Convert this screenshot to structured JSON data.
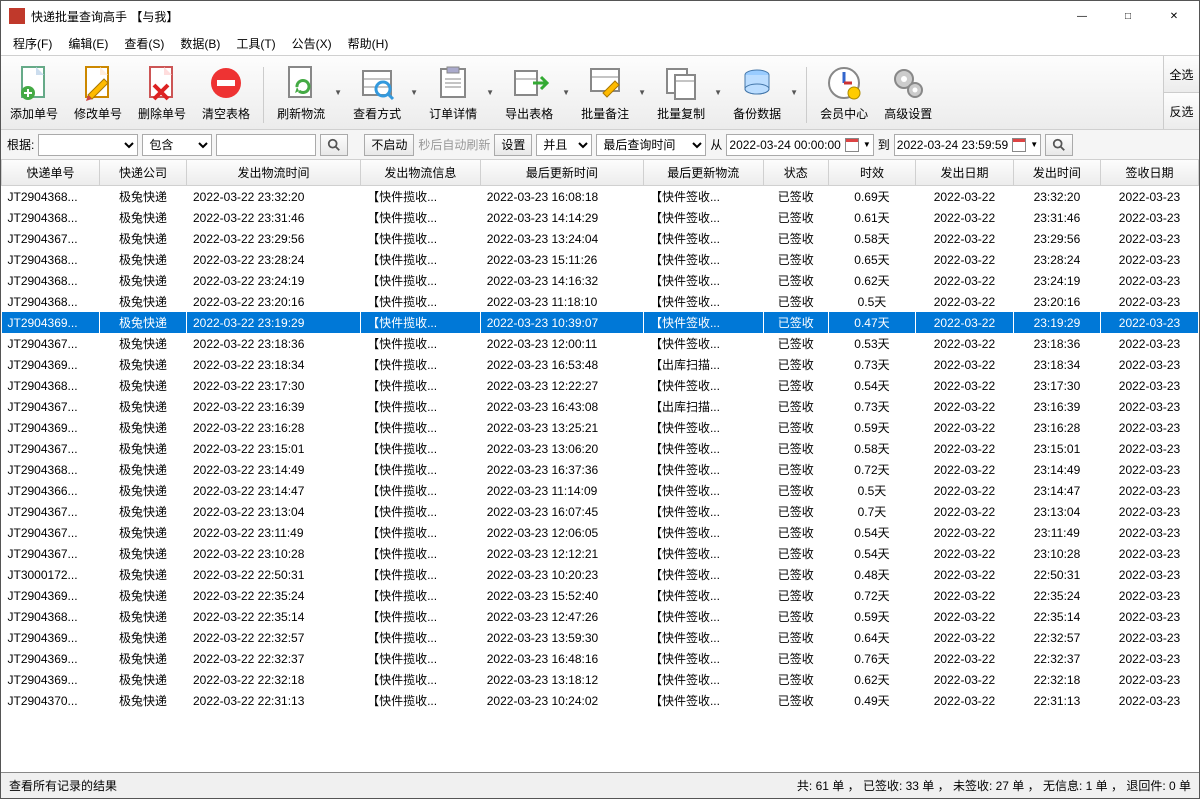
{
  "window": {
    "title": "快递批量查询高手 【与我】"
  },
  "menu": [
    "程序(F)",
    "编辑(E)",
    "查看(S)",
    "数据(B)",
    "工具(T)",
    "公告(X)",
    "帮助(H)"
  ],
  "toolbar": [
    {
      "id": "add",
      "label": "添加单号"
    },
    {
      "id": "edit",
      "label": "修改单号"
    },
    {
      "id": "del",
      "label": "删除单号"
    },
    {
      "id": "clear",
      "label": "清空表格"
    },
    {
      "id": "sep"
    },
    {
      "id": "refresh",
      "label": "刷新物流",
      "dd": true
    },
    {
      "id": "view",
      "label": "查看方式",
      "dd": true
    },
    {
      "id": "detail",
      "label": "订单详情",
      "dd": true
    },
    {
      "id": "export",
      "label": "导出表格",
      "dd": true
    },
    {
      "id": "remark",
      "label": "批量备注",
      "dd": true
    },
    {
      "id": "copy",
      "label": "批量复制",
      "dd": true
    },
    {
      "id": "backup",
      "label": "备份数据",
      "dd": true
    },
    {
      "id": "sep"
    },
    {
      "id": "vip",
      "label": "会员中心"
    },
    {
      "id": "adv",
      "label": "高级设置"
    }
  ],
  "side": {
    "all": "全选",
    "inv": "反选"
  },
  "filter": {
    "label_root": "根据:",
    "combo1": "",
    "combo2": "包含",
    "btn_no_start": "不启动",
    "hint": "秒后自动刷新",
    "btn_settings": "设置",
    "combo3": "并且",
    "combo4": "最后查询时间",
    "from": "从",
    "date_from": "2022-03-24 00:00:00",
    "to": "到",
    "date_to": "2022-03-24 23:59:59"
  },
  "columns": [
    "快递单号",
    "快递公司",
    "发出物流时间",
    "发出物流信息",
    "最后更新时间",
    "最后更新物流",
    "状态",
    "时效",
    "发出日期",
    "发出时间",
    "签收日期"
  ],
  "selected_row": 6,
  "rows": [
    [
      "JT2904368...",
      "极兔快递",
      "2022-03-22 23:32:20",
      "【快件揽收...",
      "2022-03-23 16:08:18",
      "【快件签收...",
      "已签收",
      "0.69天",
      "2022-03-22",
      "23:32:20",
      "2022-03-23"
    ],
    [
      "JT2904368...",
      "极兔快递",
      "2022-03-22 23:31:46",
      "【快件揽收...",
      "2022-03-23 14:14:29",
      "【快件签收...",
      "已签收",
      "0.61天",
      "2022-03-22",
      "23:31:46",
      "2022-03-23"
    ],
    [
      "JT2904367...",
      "极兔快递",
      "2022-03-22 23:29:56",
      "【快件揽收...",
      "2022-03-23 13:24:04",
      "【快件签收...",
      "已签收",
      "0.58天",
      "2022-03-22",
      "23:29:56",
      "2022-03-23"
    ],
    [
      "JT2904368...",
      "极兔快递",
      "2022-03-22 23:28:24",
      "【快件揽收...",
      "2022-03-23 15:11:26",
      "【快件签收...",
      "已签收",
      "0.65天",
      "2022-03-22",
      "23:28:24",
      "2022-03-23"
    ],
    [
      "JT2904368...",
      "极兔快递",
      "2022-03-22 23:24:19",
      "【快件揽收...",
      "2022-03-23 14:16:32",
      "【快件签收...",
      "已签收",
      "0.62天",
      "2022-03-22",
      "23:24:19",
      "2022-03-23"
    ],
    [
      "JT2904368...",
      "极兔快递",
      "2022-03-22 23:20:16",
      "【快件揽收...",
      "2022-03-23 11:18:10",
      "【快件签收...",
      "已签收",
      "0.5天",
      "2022-03-22",
      "23:20:16",
      "2022-03-23"
    ],
    [
      "JT2904369...",
      "极兔快递",
      "2022-03-22 23:19:29",
      "【快件揽收...",
      "2022-03-23 10:39:07",
      "【快件签收...",
      "已签收",
      "0.47天",
      "2022-03-22",
      "23:19:29",
      "2022-03-23"
    ],
    [
      "JT2904367...",
      "极兔快递",
      "2022-03-22 23:18:36",
      "【快件揽收...",
      "2022-03-23 12:00:11",
      "【快件签收...",
      "已签收",
      "0.53天",
      "2022-03-22",
      "23:18:36",
      "2022-03-23"
    ],
    [
      "JT2904369...",
      "极兔快递",
      "2022-03-22 23:18:34",
      "【快件揽收...",
      "2022-03-23 16:53:48",
      "【出库扫描...",
      "已签收",
      "0.73天",
      "2022-03-22",
      "23:18:34",
      "2022-03-23"
    ],
    [
      "JT2904368...",
      "极兔快递",
      "2022-03-22 23:17:30",
      "【快件揽收...",
      "2022-03-23 12:22:27",
      "【快件签收...",
      "已签收",
      "0.54天",
      "2022-03-22",
      "23:17:30",
      "2022-03-23"
    ],
    [
      "JT2904367...",
      "极兔快递",
      "2022-03-22 23:16:39",
      "【快件揽收...",
      "2022-03-23 16:43:08",
      "【出库扫描...",
      "已签收",
      "0.73天",
      "2022-03-22",
      "23:16:39",
      "2022-03-23"
    ],
    [
      "JT2904369...",
      "极兔快递",
      "2022-03-22 23:16:28",
      "【快件揽收...",
      "2022-03-23 13:25:21",
      "【快件签收...",
      "已签收",
      "0.59天",
      "2022-03-22",
      "23:16:28",
      "2022-03-23"
    ],
    [
      "JT2904367...",
      "极兔快递",
      "2022-03-22 23:15:01",
      "【快件揽收...",
      "2022-03-23 13:06:20",
      "【快件签收...",
      "已签收",
      "0.58天",
      "2022-03-22",
      "23:15:01",
      "2022-03-23"
    ],
    [
      "JT2904368...",
      "极兔快递",
      "2022-03-22 23:14:49",
      "【快件揽收...",
      "2022-03-23 16:37:36",
      "【快件签收...",
      "已签收",
      "0.72天",
      "2022-03-22",
      "23:14:49",
      "2022-03-23"
    ],
    [
      "JT2904366...",
      "极兔快递",
      "2022-03-22 23:14:47",
      "【快件揽收...",
      "2022-03-23 11:14:09",
      "【快件签收...",
      "已签收",
      "0.5天",
      "2022-03-22",
      "23:14:47",
      "2022-03-23"
    ],
    [
      "JT2904367...",
      "极兔快递",
      "2022-03-22 23:13:04",
      "【快件揽收...",
      "2022-03-23 16:07:45",
      "【快件签收...",
      "已签收",
      "0.7天",
      "2022-03-22",
      "23:13:04",
      "2022-03-23"
    ],
    [
      "JT2904367...",
      "极兔快递",
      "2022-03-22 23:11:49",
      "【快件揽收...",
      "2022-03-23 12:06:05",
      "【快件签收...",
      "已签收",
      "0.54天",
      "2022-03-22",
      "23:11:49",
      "2022-03-23"
    ],
    [
      "JT2904367...",
      "极兔快递",
      "2022-03-22 23:10:28",
      "【快件揽收...",
      "2022-03-23 12:12:21",
      "【快件签收...",
      "已签收",
      "0.54天",
      "2022-03-22",
      "23:10:28",
      "2022-03-23"
    ],
    [
      "JT3000172...",
      "极兔快递",
      "2022-03-22 22:50:31",
      "【快件揽收...",
      "2022-03-23 10:20:23",
      "【快件签收...",
      "已签收",
      "0.48天",
      "2022-03-22",
      "22:50:31",
      "2022-03-23"
    ],
    [
      "JT2904369...",
      "极兔快递",
      "2022-03-22 22:35:24",
      "【快件揽收...",
      "2022-03-23 15:52:40",
      "【快件签收...",
      "已签收",
      "0.72天",
      "2022-03-22",
      "22:35:24",
      "2022-03-23"
    ],
    [
      "JT2904368...",
      "极兔快递",
      "2022-03-22 22:35:14",
      "【快件揽收...",
      "2022-03-23 12:47:26",
      "【快件签收...",
      "已签收",
      "0.59天",
      "2022-03-22",
      "22:35:14",
      "2022-03-23"
    ],
    [
      "JT2904369...",
      "极兔快递",
      "2022-03-22 22:32:57",
      "【快件揽收...",
      "2022-03-23 13:59:30",
      "【快件签收...",
      "已签收",
      "0.64天",
      "2022-03-22",
      "22:32:57",
      "2022-03-23"
    ],
    [
      "JT2904369...",
      "极兔快递",
      "2022-03-22 22:32:37",
      "【快件揽收...",
      "2022-03-23 16:48:16",
      "【快件签收...",
      "已签收",
      "0.76天",
      "2022-03-22",
      "22:32:37",
      "2022-03-23"
    ],
    [
      "JT2904369...",
      "极兔快递",
      "2022-03-22 22:32:18",
      "【快件揽收...",
      "2022-03-23 13:18:12",
      "【快件签收...",
      "已签收",
      "0.62天",
      "2022-03-22",
      "22:32:18",
      "2022-03-23"
    ],
    [
      "JT2904370...",
      "极兔快递",
      "2022-03-22 22:31:13",
      "【快件揽收...",
      "2022-03-23 10:24:02",
      "【快件签收...",
      "已签收",
      "0.49天",
      "2022-03-22",
      "22:31:13",
      "2022-03-23"
    ]
  ],
  "status": {
    "left": "查看所有记录的结果",
    "right": "共: 61 单 ， 已签收:   33 单 ， 未签收:   27 单 ， 无信息: 1 单 ， 退回件: 0 单"
  }
}
